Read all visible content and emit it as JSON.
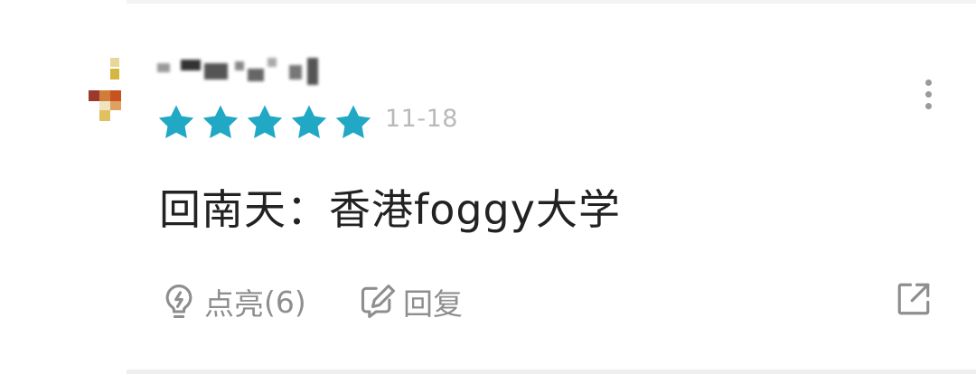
{
  "comment": {
    "rating_stars": 5,
    "star_color": "#20a8c4",
    "date": "11-18",
    "content": "回南天：香港foggy大学",
    "actions": {
      "like_label": "点亮",
      "like_count": "(6)",
      "reply_label": "回复"
    },
    "icons": {
      "more": "more-vertical-icon",
      "like": "lightbulb-icon",
      "reply": "edit-reply-icon",
      "share": "share-external-icon"
    }
  }
}
